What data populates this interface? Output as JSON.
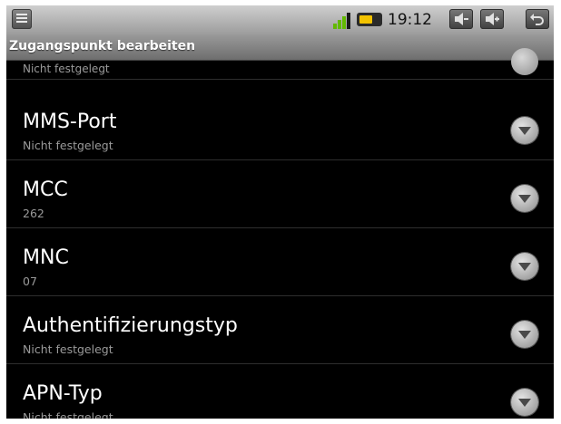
{
  "statusbar": {
    "time": "19:12",
    "menu_icon": "menu-icon",
    "signal_icon": "signal-icon",
    "battery_icon": "battery-icon",
    "volume_down_icon": "volume-down-icon",
    "volume_up_icon": "volume-up-icon",
    "back_icon": "back-icon"
  },
  "header": {
    "title": "Zugangspunkt bearbeiten"
  },
  "list": {
    "partial_summary": "Nicht festgelegt",
    "items": [
      {
        "label": "MMS-Port",
        "summary": "Nicht festgelegt"
      },
      {
        "label": "MCC",
        "summary": "262"
      },
      {
        "label": "MNC",
        "summary": "07"
      },
      {
        "label": "Authentifizierungstyp",
        "summary": "Nicht festgelegt"
      },
      {
        "label": "APN-Typ",
        "summary": "Nicht festgelegt"
      }
    ]
  },
  "colors": {
    "background": "#000000",
    "primary_text": "#ffffff",
    "secondary_text": "#9a9a9a",
    "signal_green": "#62b900",
    "battery_yellow": "#f2c200"
  }
}
